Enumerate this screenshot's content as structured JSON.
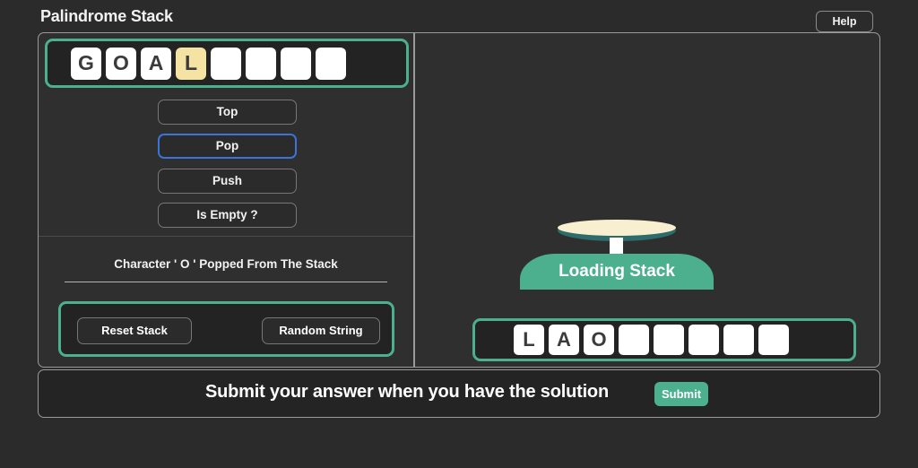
{
  "header": {
    "title": "Palindrome Stack",
    "help_label": "Help"
  },
  "colors": {
    "accent_green": "#4cb08e",
    "tile_white": "#ffffff",
    "tile_highlight": "#f5e3a3",
    "focus_blue": "#3b74d8",
    "table_top_cream": "#f7efcf",
    "table_rim_teal": "#2e6b6b",
    "page_background": "#2b2b2b",
    "panel_background": "#2f2f2f"
  },
  "left_pane": {
    "input_tiles": [
      {
        "letter": "G",
        "state": "filled"
      },
      {
        "letter": "O",
        "state": "filled"
      },
      {
        "letter": "A",
        "state": "filled"
      },
      {
        "letter": "L",
        "state": "highlight"
      },
      {
        "letter": "",
        "state": "empty"
      },
      {
        "letter": "",
        "state": "empty"
      },
      {
        "letter": "",
        "state": "empty"
      },
      {
        "letter": "",
        "state": "empty"
      }
    ],
    "operations": [
      {
        "label": "Top",
        "focused": false
      },
      {
        "label": "Pop",
        "focused": true
      },
      {
        "label": "Push",
        "focused": false
      },
      {
        "label": "Is Empty ?",
        "focused": false
      }
    ],
    "status_message": "Character ' O ' Popped From The Stack",
    "actions": {
      "reset_label": "Reset Stack",
      "random_label": "Random String"
    }
  },
  "right_pane": {
    "stack_label": "Loading Stack",
    "output_tiles": [
      {
        "letter": "L",
        "state": "filled"
      },
      {
        "letter": "A",
        "state": "filled"
      },
      {
        "letter": "O",
        "state": "filled"
      },
      {
        "letter": "",
        "state": "empty"
      },
      {
        "letter": "",
        "state": "empty"
      },
      {
        "letter": "",
        "state": "empty"
      },
      {
        "letter": "",
        "state": "empty"
      },
      {
        "letter": "",
        "state": "empty"
      }
    ]
  },
  "footer": {
    "prompt": "Submit your answer when you have the solution",
    "submit_label": "Submit"
  }
}
